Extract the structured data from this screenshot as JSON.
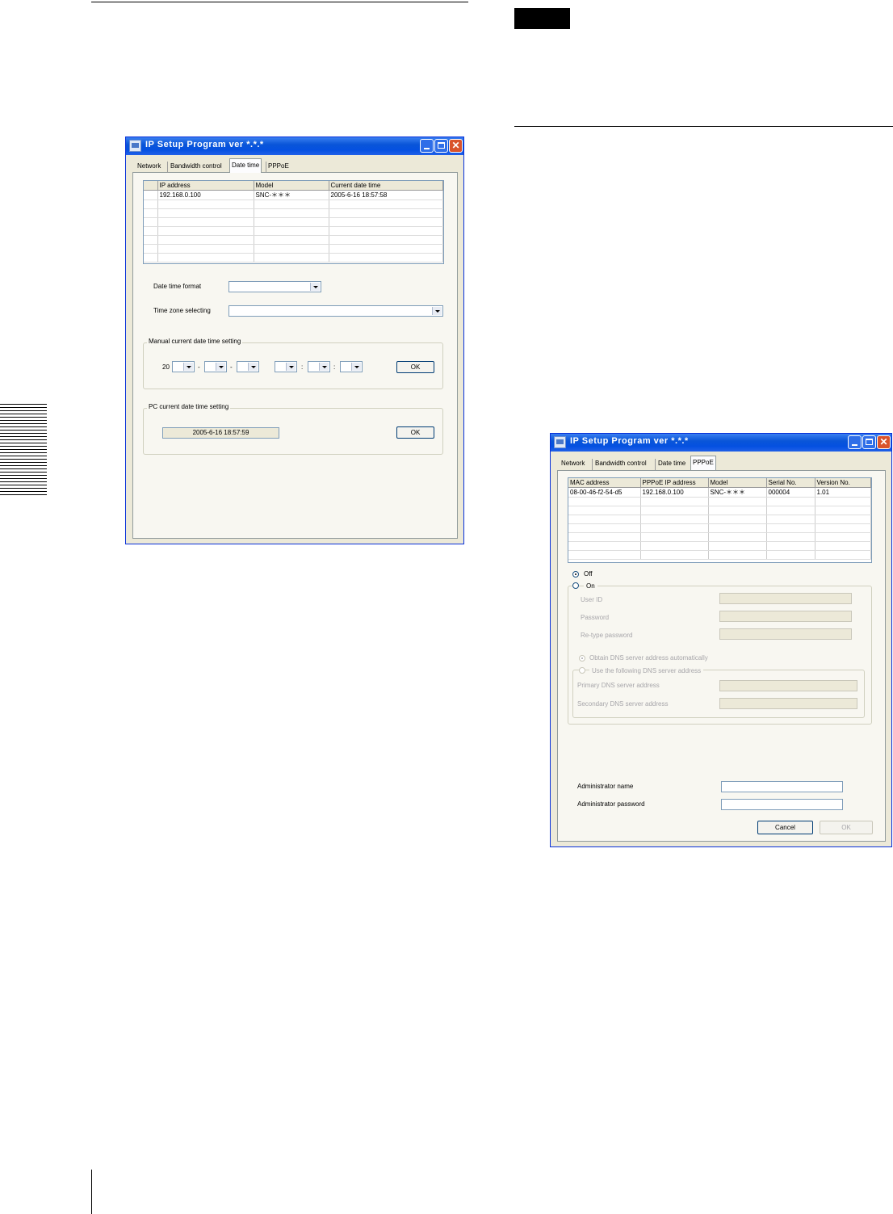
{
  "window_datetime": {
    "title": "IP Setup Program ver *.*.*",
    "tabs": [
      "Network",
      "Bandwidth control",
      "Date time",
      "PPPoE"
    ],
    "table": {
      "headers": [
        "IP address",
        "Model",
        "Current date time"
      ],
      "rows": [
        [
          "192.168.0.100",
          "SNC-＊＊＊",
          "2005-6-16  18:57:58"
        ]
      ]
    },
    "date_time_format_label": "Date time format",
    "time_zone_label": "Time zone selecting",
    "manual_group_label": "Manual current date time setting",
    "year_prefix": "20",
    "date_sep": "-",
    "time_sep": ":",
    "manual_ok": "OK",
    "pc_group_label": "PC current date time setting",
    "pc_date_time": "2005-6-16     18:57:59",
    "pc_ok": "OK"
  },
  "window_pppoe": {
    "title": "IP Setup Program ver *.*.*",
    "tabs": [
      "Network",
      "Bandwidth control",
      "Date time",
      "PPPoE"
    ],
    "table": {
      "headers": [
        "MAC address",
        "PPPoE IP address",
        "Model",
        "Serial No.",
        "Version No."
      ],
      "rows": [
        [
          "08-00-46-f2-54-d5",
          "192.168.0.100",
          "SNC-＊＊＊",
          "000004",
          "1.01"
        ]
      ]
    },
    "off_label": "Off",
    "on_label": "On",
    "user_id_label": "User ID",
    "password_label": "Password",
    "retype_label": "Re-type password",
    "dns_auto_label": "Obtain DNS server address automatically",
    "dns_manual_label": "Use the following DNS server address",
    "primary_dns_label": "Primary DNS server address",
    "secondary_dns_label": "Secondary DNS server address",
    "admin_name_label": "Administrator name",
    "admin_password_label": "Administrator password",
    "cancel_label": "Cancel",
    "ok_label": "OK"
  }
}
